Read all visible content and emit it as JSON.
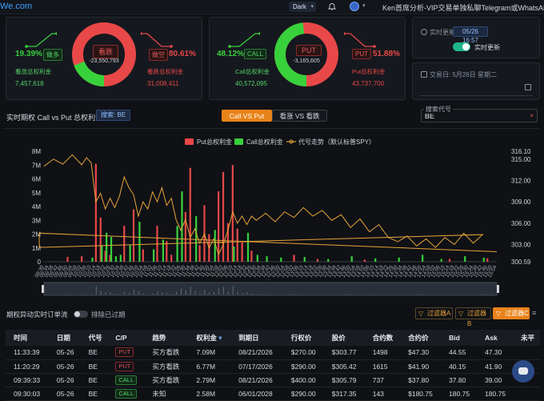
{
  "topbar": {
    "brand": "We.com",
    "theme_label": "Dark",
    "theme_chevron": "chevron-down-icon",
    "promo_text": "Ken首席分析-VIP交易单独私聊Telegram或WhatsAPP▾"
  },
  "card_bear": {
    "left_pct": "19.39%",
    "left_tag": "做多",
    "left_label": "看涨总权利金",
    "left_value": "7,457,618",
    "center_label": "看跌",
    "center_value": "-23,550,793",
    "right_tag": "做空",
    "right_pct": "80.61%",
    "right_label": "看跌总权利金",
    "right_value": "31,008,411",
    "green_fraction": 0.1939
  },
  "card_put": {
    "left_pct": "48.12%",
    "left_tag": "CALL",
    "left_label": "Call总权利金",
    "left_value": "40,572,095",
    "center_label": "PUT",
    "center_value": "-3,165,605",
    "right_tag": "PUT",
    "right_pct": "51.88%",
    "right_label": "Put总权利金",
    "right_value": "43,737,700",
    "green_fraction": 0.4812
  },
  "realtime": {
    "label": "实时更新:",
    "time": "05/26 16:57",
    "update_label": "实时更新"
  },
  "tradeday": {
    "label": "交易日: 5月26日 星期二"
  },
  "section": {
    "title": "实时期权 Call vs Put 总权利金",
    "search_badge": "搜索: BE",
    "tab_a": "Call VS Put",
    "tab_b": "看涨 VS 看跌",
    "search_code_label": "搜索代号",
    "search_code_value": "BE",
    "search_clear": "×"
  },
  "chart_data": {
    "type": "bar",
    "legend": [
      "Put总权利金",
      "Call总权利金",
      "代号走势（默认标普SPY）"
    ],
    "y_left_ticks": [
      "8M",
      "7M",
      "6M",
      "5M",
      "4M",
      "3M",
      "2M",
      "1M",
      "0"
    ],
    "y_right_ticks": [
      "316.10",
      "315.00",
      "312.00",
      "309.00",
      "306.00",
      "303.00",
      "300.59"
    ],
    "x_ticks": [
      "09:30",
      "09:34",
      "09:38",
      "09:42",
      "09:46",
      "09:50",
      "09:54",
      "09:58",
      "10:02",
      "10:06",
      "10:10",
      "10:14",
      "10:18",
      "10:22",
      "10:26",
      "10:30",
      "10:34",
      "10:38",
      "10:42",
      "10:46",
      "10:50",
      "10:54",
      "10:58",
      "11:02",
      "11:06",
      "11:10",
      "11:14",
      "11:18",
      "11:22",
      "11:26",
      "11:30",
      "11:34",
      "11:38",
      "11:42",
      "11:46",
      "11:50",
      "11:54",
      "11:58",
      "12:02",
      "12:06",
      "12:10",
      "12:14",
      "12:18",
      "12:22",
      "12:26",
      "12:30",
      "12:34",
      "12:38",
      "12:42",
      "12:46",
      "12:50",
      "12:54",
      "12:58",
      "13:02",
      "13:06",
      "13:10",
      "13:14",
      "13:18",
      "13:22",
      "13:26",
      "13:30",
      "13:34",
      "13:38",
      "13:42",
      "13:46",
      "13:50",
      "13:54",
      "13:58",
      "14:02",
      "14:06",
      "14:10",
      "14:14",
      "14:18",
      "14:22",
      "14:26",
      "14:30",
      "14:34",
      "14:38",
      "14:42",
      "14:46",
      "14:50",
      "14:54",
      "14:58",
      "15:02",
      "15:06",
      "15:10",
      "15:14",
      "15:18",
      "15:22",
      "15:26",
      "15:30",
      "15:34",
      "15:38",
      "15:42",
      "15:46",
      "15:50",
      "15:54"
    ],
    "x_tick_labels_shown": [
      "09:30",
      "09:34",
      "09:38",
      "09:42",
      "09:46",
      "09:50",
      "09:54",
      "09:58",
      "10:02",
      "10:06",
      "10:10",
      "10:14",
      "10:18",
      "10:22",
      "10:26",
      "10:30",
      "10:34",
      "10:38",
      "10:42",
      "10:46",
      "10:50",
      "10:54",
      "10:58",
      "11:02",
      "11:06",
      "11:10",
      "11:14",
      "11:18",
      "11:22",
      "11:26",
      "11:30",
      "11:34",
      "11:38",
      "11:42",
      "11:46",
      "11:50",
      "11:54",
      "11:58",
      "12:02",
      "12:06",
      "12:10",
      "12:14",
      "12:18",
      "12:22",
      "12:26",
      "12:30",
      "12:34",
      "12:38",
      "12:42",
      "12:46",
      "12:50",
      "12:54",
      "12:58",
      "13:02",
      "13:06",
      "13:10",
      "13:14",
      "13:18",
      "13:22",
      "13:26",
      "13:30",
      "13:34",
      "13:38",
      "13:42",
      "13:46",
      "13:50",
      "13:54",
      "13:58",
      "14:02",
      "14:06",
      "14:10",
      "14:14",
      "14:18",
      "14:22",
      "14:26",
      "14:30",
      "14:34",
      "14:38",
      "14:42",
      "14:46",
      "14:50",
      "14:54",
      "14:58",
      "15:02",
      "15:06",
      "15:10",
      "15:14",
      "15:18",
      "15:22",
      "15:26",
      "15:30",
      "15:34",
      "15:38",
      "15:42",
      "15:46",
      "15:50",
      "15:54"
    ],
    "ylim_left": [
      0,
      8000000
    ],
    "ylim_right": [
      300.59,
      316.1
    ],
    "put_bars": [
      {
        "x": "09:50",
        "v": 350000
      },
      {
        "x": "10:02",
        "v": 400000
      },
      {
        "x": "10:14",
        "v": 7100000
      },
      {
        "x": "10:18",
        "v": 3200000
      },
      {
        "x": "10:22",
        "v": 800000
      },
      {
        "x": "10:26",
        "v": 500000
      },
      {
        "x": "10:38",
        "v": 2600000
      },
      {
        "x": "10:46",
        "v": 3800000
      },
      {
        "x": "10:54",
        "v": 900000
      },
      {
        "x": "11:06",
        "v": 2600000
      },
      {
        "x": "11:14",
        "v": 1500000
      },
      {
        "x": "11:18",
        "v": 500000
      },
      {
        "x": "11:30",
        "v": 3600000
      },
      {
        "x": "11:34",
        "v": 6800000
      },
      {
        "x": "11:42",
        "v": 1200000
      },
      {
        "x": "11:46",
        "v": 4100000
      },
      {
        "x": "11:50",
        "v": 2000000
      },
      {
        "x": "11:58",
        "v": 5100000
      },
      {
        "x": "12:02",
        "v": 6500000
      },
      {
        "x": "12:06",
        "v": 2800000
      },
      {
        "x": "12:10",
        "v": 7000000
      },
      {
        "x": "12:14",
        "v": 2400000
      },
      {
        "x": "12:18",
        "v": 1400000
      },
      {
        "x": "12:26",
        "v": 800000
      },
      {
        "x": "13:02",
        "v": 500000
      },
      {
        "x": "13:22",
        "v": 200000
      },
      {
        "x": "14:02",
        "v": 150000
      },
      {
        "x": "15:14",
        "v": 200000
      },
      {
        "x": "15:46",
        "v": 250000
      }
    ],
    "call_bars": [
      {
        "x": "10:10",
        "v": 300000
      },
      {
        "x": "10:18",
        "v": 1200000
      },
      {
        "x": "10:22",
        "v": 2100000
      },
      {
        "x": "10:26",
        "v": 1800000
      },
      {
        "x": "10:30",
        "v": 400000
      },
      {
        "x": "10:34",
        "v": 500000
      },
      {
        "x": "10:42",
        "v": 1200000
      },
      {
        "x": "10:50",
        "v": 2900000
      },
      {
        "x": "11:02",
        "v": 900000
      },
      {
        "x": "11:10",
        "v": 1600000
      },
      {
        "x": "11:22",
        "v": 2600000
      },
      {
        "x": "11:26",
        "v": 5100000
      },
      {
        "x": "11:38",
        "v": 3300000
      },
      {
        "x": "11:54",
        "v": 2300000
      },
      {
        "x": "12:10",
        "v": 1100000
      },
      {
        "x": "12:22",
        "v": 2100000
      },
      {
        "x": "12:30",
        "v": 500000
      },
      {
        "x": "12:38",
        "v": 400000
      },
      {
        "x": "12:50",
        "v": 300000
      },
      {
        "x": "13:10",
        "v": 350000
      },
      {
        "x": "13:30",
        "v": 200000
      },
      {
        "x": "13:50",
        "v": 400000
      },
      {
        "x": "14:10",
        "v": 250000
      },
      {
        "x": "14:30",
        "v": 300000
      },
      {
        "x": "14:50",
        "v": 500000
      },
      {
        "x": "15:06",
        "v": 200000
      },
      {
        "x": "15:26",
        "v": 400000
      },
      {
        "x": "15:42",
        "v": 300000
      }
    ],
    "spy_line": [
      {
        "x": "09:30",
        "v": 314.0
      },
      {
        "x": "09:38",
        "v": 315.0
      },
      {
        "x": "09:46",
        "v": 314.3
      },
      {
        "x": "09:54",
        "v": 315.6
      },
      {
        "x": "10:02",
        "v": 314.2
      },
      {
        "x": "10:06",
        "v": 315.2
      },
      {
        "x": "10:10",
        "v": 314.5
      },
      {
        "x": "10:14",
        "v": 309.0
      },
      {
        "x": "10:18",
        "v": 310.2
      },
      {
        "x": "10:22",
        "v": 308.0
      },
      {
        "x": "10:26",
        "v": 309.5
      },
      {
        "x": "10:30",
        "v": 308.2
      },
      {
        "x": "10:34",
        "v": 309.8
      },
      {
        "x": "10:38",
        "v": 312.5
      },
      {
        "x": "10:42",
        "v": 311.0
      },
      {
        "x": "10:46",
        "v": 310.0
      },
      {
        "x": "10:50",
        "v": 307.0
      },
      {
        "x": "10:54",
        "v": 309.0
      },
      {
        "x": "10:58",
        "v": 308.0
      },
      {
        "x": "11:02",
        "v": 310.4
      },
      {
        "x": "11:06",
        "v": 309.0
      },
      {
        "x": "11:10",
        "v": 311.0
      },
      {
        "x": "11:14",
        "v": 308.5
      },
      {
        "x": "11:18",
        "v": 309.5
      },
      {
        "x": "11:22",
        "v": 306.5
      },
      {
        "x": "11:26",
        "v": 305.0
      },
      {
        "x": "11:30",
        "v": 306.5
      },
      {
        "x": "11:34",
        "v": 304.0
      },
      {
        "x": "11:38",
        "v": 305.2
      },
      {
        "x": "11:42",
        "v": 303.2
      },
      {
        "x": "11:46",
        "v": 304.5
      },
      {
        "x": "11:50",
        "v": 302.5
      },
      {
        "x": "11:54",
        "v": 303.8
      },
      {
        "x": "11:58",
        "v": 301.6
      },
      {
        "x": "12:02",
        "v": 303.0
      },
      {
        "x": "12:06",
        "v": 305.0
      },
      {
        "x": "12:10",
        "v": 307.6
      },
      {
        "x": "12:14",
        "v": 306.0
      },
      {
        "x": "12:18",
        "v": 307.0
      },
      {
        "x": "12:22",
        "v": 305.8
      },
      {
        "x": "12:26",
        "v": 307.0
      },
      {
        "x": "12:30",
        "v": 306.4
      },
      {
        "x": "12:38",
        "v": 307.4
      },
      {
        "x": "12:46",
        "v": 306.2
      },
      {
        "x": "12:54",
        "v": 307.6
      },
      {
        "x": "13:02",
        "v": 306.8
      },
      {
        "x": "13:10",
        "v": 308.2
      },
      {
        "x": "13:18",
        "v": 307.0
      },
      {
        "x": "13:26",
        "v": 307.8
      },
      {
        "x": "13:34",
        "v": 306.4
      },
      {
        "x": "13:42",
        "v": 307.2
      },
      {
        "x": "13:50",
        "v": 305.4
      },
      {
        "x": "13:58",
        "v": 306.6
      },
      {
        "x": "14:06",
        "v": 304.8
      },
      {
        "x": "14:14",
        "v": 305.8
      },
      {
        "x": "14:22",
        "v": 304.0
      },
      {
        "x": "14:30",
        "v": 303.4
      },
      {
        "x": "14:38",
        "v": 304.2
      },
      {
        "x": "14:46",
        "v": 302.8
      },
      {
        "x": "14:54",
        "v": 303.8
      },
      {
        "x": "15:02",
        "v": 302.6
      },
      {
        "x": "15:10",
        "v": 304.0
      },
      {
        "x": "15:18",
        "v": 303.0
      },
      {
        "x": "15:26",
        "v": 304.6
      },
      {
        "x": "15:34",
        "v": 303.2
      },
      {
        "x": "15:42",
        "v": 304.4
      },
      {
        "x": "15:48",
        "v": 302.6
      },
      {
        "x": "15:52",
        "v": 304.6
      },
      {
        "x": "15:54",
        "v": 302.0
      }
    ],
    "colors": {
      "put": "#e84848",
      "call": "#38d13c",
      "line": "#e8a33a"
    }
  },
  "flow": {
    "title": "期权异动实时订单流",
    "exclude_label": "排除已过期",
    "filter_a": "过滤器A",
    "filter_b": "过滤器B",
    "filter_c": "过滤器C",
    "headers": [
      "时间",
      "日期",
      "代号",
      "C/P",
      "趋势",
      "权利金",
      "到期日",
      "行权价",
      "股价",
      "合约数",
      "合约价",
      "Bid",
      "Ask",
      "未平"
    ],
    "rows": [
      {
        "time": "11:33:39",
        "date": "05-26",
        "code": "BE",
        "cp": "PUT",
        "trend": "买方看跌",
        "premium": "7.09M",
        "expiry": "08/21/2026",
        "strike": "$270.00",
        "stock": "$303.77",
        "contracts": "1498",
        "price": "$47.30",
        "bid": "44.55",
        "ask": "47.30"
      },
      {
        "time": "11:20:29",
        "date": "05-26",
        "code": "BE",
        "cp": "PUT",
        "trend": "买方看跌",
        "premium": "6.77M",
        "expiry": "07/17/2026",
        "strike": "$290.00",
        "stock": "$305.42",
        "contracts": "1615",
        "price": "$41.90",
        "bid": "40.15",
        "ask": "41.90"
      },
      {
        "time": "09:39:33",
        "date": "05-26",
        "code": "BE",
        "cp": "CALL",
        "trend": "买方看跌",
        "premium": "2.79M",
        "expiry": "08/21/2026",
        "strike": "$400.00",
        "stock": "$305.79",
        "contracts": "737",
        "price": "$37.80",
        "bid": "37.80",
        "ask": "39.00"
      },
      {
        "time": "09:30:03",
        "date": "05-26",
        "code": "BE",
        "cp": "CALL",
        "trend": "未知",
        "premium": "2.58M",
        "expiry": "06/01/2028",
        "strike": "$290.00",
        "stock": "$317.35",
        "contracts": "143",
        "price": "$180.75",
        "bid": "180.75",
        "ask": "180.75"
      }
    ]
  }
}
